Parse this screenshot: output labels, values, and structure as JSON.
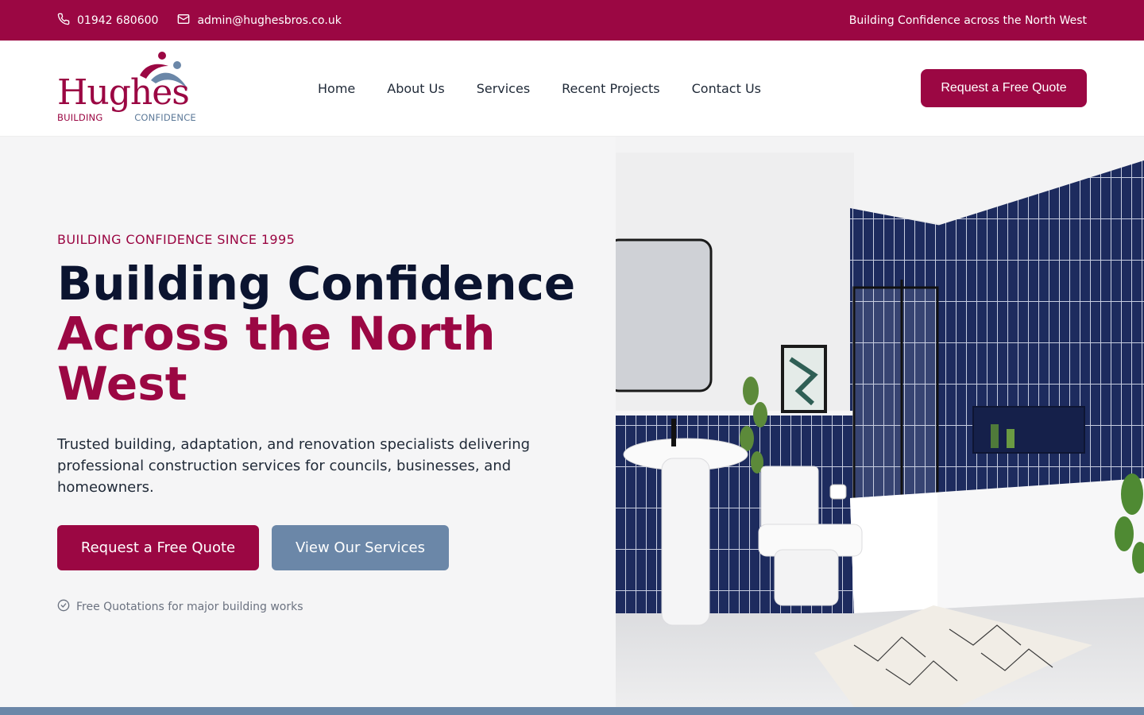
{
  "topbar": {
    "phone": "01942 680600",
    "email": "admin@hughesbros.co.uk",
    "tagline": "Building Confidence across the North West"
  },
  "brand": {
    "name": "Hughes",
    "sub_left": "BUILDING",
    "sub_right": "CONFIDENCE",
    "primary_color": "#9b0743",
    "secondary_color": "#6b87a8"
  },
  "nav": {
    "items": [
      "Home",
      "About Us",
      "Services",
      "Recent Projects",
      "Contact Us"
    ],
    "cta": "Request a Free Quote"
  },
  "hero": {
    "eyebrow": "BUILDING CONFIDENCE SINCE 1995",
    "headline_line1": "Building Confidence",
    "headline_line2": "Across the North West",
    "lede": "Trusted building, adaptation, and renovation specialists delivering professional construction services for councils, businesses, and homeowners.",
    "primary_button": "Request a Free Quote",
    "secondary_button": "View Our Services",
    "note": "Free Quotations for major building works"
  },
  "icons": {
    "phone": "phone-icon",
    "email": "mail-icon",
    "check": "check-circle-icon"
  }
}
